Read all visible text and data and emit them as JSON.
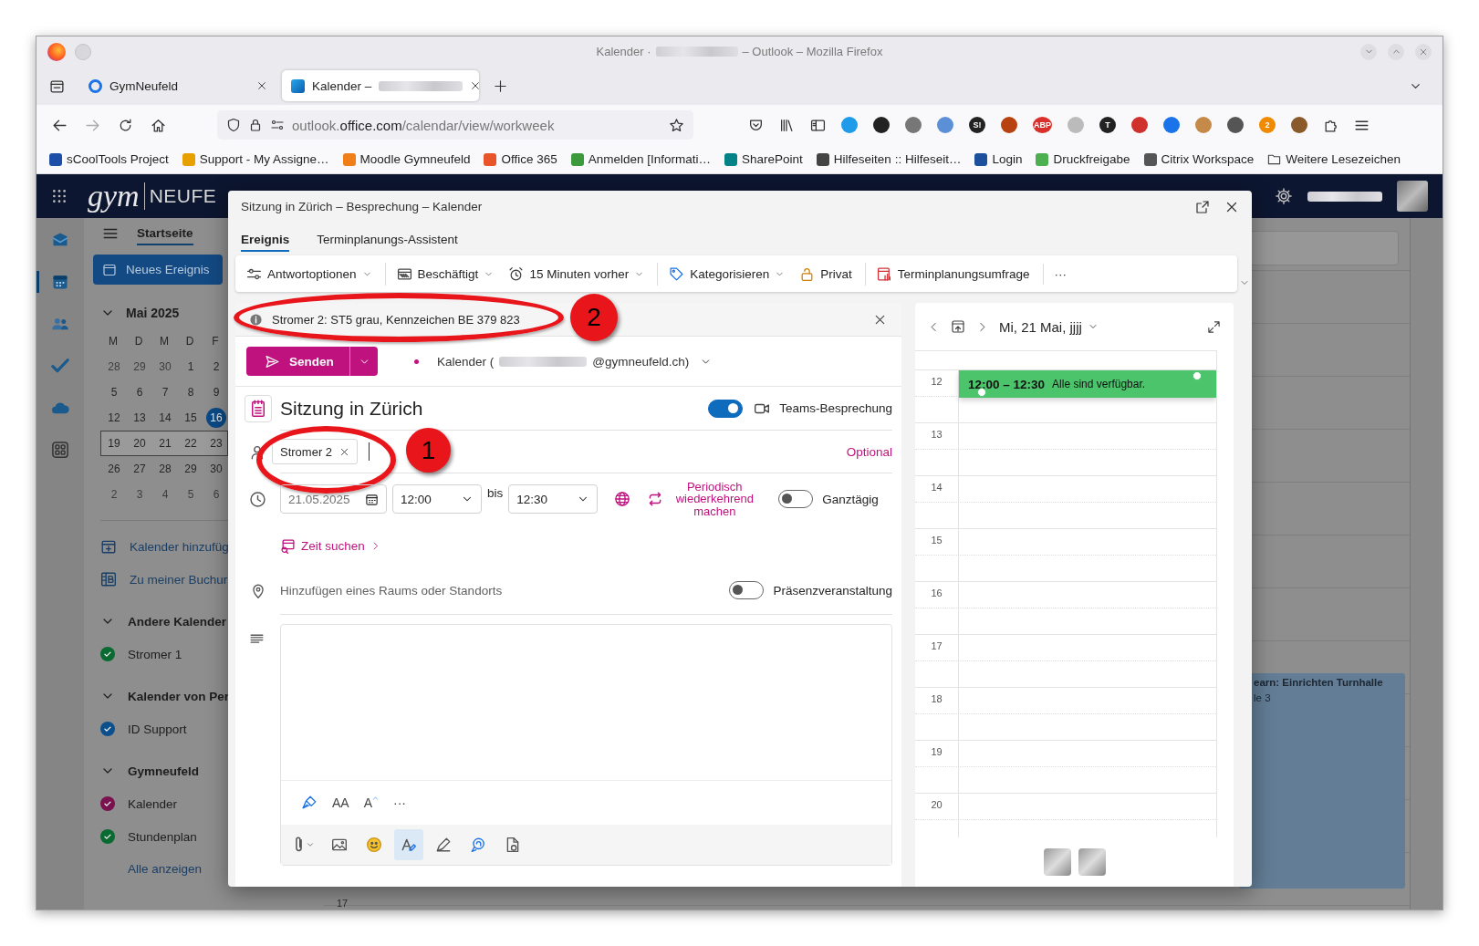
{
  "browser": {
    "title": {
      "prefix": "Kalender ·",
      "redacted": true,
      "suffix": "– Outlook – Mozilla Firefox"
    },
    "tabs": [
      {
        "label": "GymNeufeld",
        "selected": false,
        "redacted": false
      },
      {
        "label": "Kalender –",
        "selected": true,
        "redacted": true
      }
    ],
    "url": [
      {
        "text": "outlook.",
        "strong": false
      },
      {
        "text": "office.com",
        "strong": true
      },
      {
        "text": "/calendar/view/workweek",
        "strong": false
      }
    ],
    "extensions": [
      {
        "kind": "pocket"
      },
      {
        "kind": "library"
      },
      {
        "kind": "sidebar"
      },
      {
        "kind": "dot",
        "color": "#1e9be9"
      },
      {
        "kind": "dot",
        "color": "#222222"
      },
      {
        "kind": "dot",
        "color": "#777777"
      },
      {
        "kind": "dot",
        "color": "#5b8fd6"
      },
      {
        "kind": "badge",
        "label": "S!",
        "color": "#222222"
      },
      {
        "kind": "dot",
        "color": "#b8420f"
      },
      {
        "kind": "badge",
        "label": "ABP",
        "color": "#d9302c"
      },
      {
        "kind": "dot",
        "color": "#bbbbbb"
      },
      {
        "kind": "badge",
        "label": "T",
        "color": "#222222"
      },
      {
        "kind": "dot",
        "color": "#d0312d"
      },
      {
        "kind": "dot",
        "color": "#1a73e8"
      },
      {
        "kind": "dot",
        "color": "#c58a4a"
      },
      {
        "kind": "dot",
        "color": "#555555"
      },
      {
        "kind": "badge",
        "label": "2",
        "color": "#f08a00"
      },
      {
        "kind": "dot",
        "color": "#8a5a2a"
      },
      {
        "kind": "puzzle"
      },
      {
        "kind": "menu"
      }
    ],
    "bookmarks": [
      {
        "kind": "site",
        "label": "sCoolTools Project",
        "color": "#1d4fa8"
      },
      {
        "kind": "site",
        "label": "Support - My Assigne…",
        "color": "#e6a100"
      },
      {
        "kind": "site",
        "label": "Moodle Gymneufeld",
        "color": "#f07f1a"
      },
      {
        "kind": "site",
        "label": "Office 365",
        "color": "#e8552a"
      },
      {
        "kind": "site",
        "label": "Anmelden [Informati…",
        "color": "#3c9a3c"
      },
      {
        "kind": "site",
        "label": "SharePoint",
        "color": "#038387"
      },
      {
        "kind": "site",
        "label": "Hilfeseiten :: Hilfeseit…",
        "color": "#444444"
      },
      {
        "kind": "site",
        "label": "Login",
        "color": "#1c4f9c"
      },
      {
        "kind": "site",
        "label": "Druckfreigabe",
        "color": "#4caf50"
      },
      {
        "kind": "site",
        "label": "Citrix Workspace",
        "color": "#555555"
      },
      {
        "kind": "folder",
        "label": "Weitere Lesezeichen",
        "color": "#444444"
      }
    ]
  },
  "outlook": {
    "brand": {
      "primary": "gym",
      "secondary": "NEUFE"
    },
    "rail": [
      {
        "kind": "mail",
        "selected": false
      },
      {
        "kind": "calendar",
        "selected": true
      },
      {
        "kind": "people",
        "selected": false
      },
      {
        "kind": "todo",
        "selected": false
      },
      {
        "kind": "cloud",
        "selected": false
      },
      {
        "kind": "apps",
        "selected": false
      }
    ],
    "nav_tabs": [
      {
        "label": "Startseite",
        "selected": true
      }
    ],
    "new_event": "Neues Ereignis",
    "mini_calendar": {
      "title": "Mai 2025",
      "weekdays": [
        "M",
        "D",
        "M",
        "D",
        "F"
      ],
      "weeks": [
        {
          "selected": false,
          "days": [
            {
              "label": "28",
              "outside": true,
              "today": false
            },
            {
              "label": "29",
              "outside": true,
              "today": false
            },
            {
              "label": "30",
              "outside": true,
              "today": false
            },
            {
              "label": "1",
              "outside": false,
              "today": false
            },
            {
              "label": "2",
              "outside": false,
              "today": false
            }
          ]
        },
        {
          "selected": false,
          "days": [
            {
              "label": "5",
              "outside": false,
              "today": false
            },
            {
              "label": "6",
              "outside": false,
              "today": false
            },
            {
              "label": "7",
              "outside": false,
              "today": false
            },
            {
              "label": "8",
              "outside": false,
              "today": false
            },
            {
              "label": "9",
              "outside": false,
              "today": false
            }
          ]
        },
        {
          "selected": false,
          "days": [
            {
              "label": "12",
              "outside": false,
              "today": false
            },
            {
              "label": "13",
              "outside": false,
              "today": false
            },
            {
              "label": "14",
              "outside": false,
              "today": false
            },
            {
              "label": "15",
              "outside": false,
              "today": false
            },
            {
              "label": "16",
              "outside": false,
              "today": true
            }
          ]
        },
        {
          "selected": true,
          "days": [
            {
              "label": "19",
              "outside": false,
              "today": false
            },
            {
              "label": "20",
              "outside": false,
              "today": false
            },
            {
              "label": "21",
              "outside": false,
              "today": false
            },
            {
              "label": "22",
              "outside": false,
              "today": false
            },
            {
              "label": "23",
              "outside": false,
              "today": false
            }
          ]
        },
        {
          "selected": false,
          "days": [
            {
              "label": "26",
              "outside": false,
              "today": false
            },
            {
              "label": "27",
              "outside": false,
              "today": false
            },
            {
              "label": "28",
              "outside": false,
              "today": false
            },
            {
              "label": "29",
              "outside": false,
              "today": false
            },
            {
              "label": "30",
              "outside": false,
              "today": false
            }
          ]
        },
        {
          "selected": false,
          "days": [
            {
              "label": "2",
              "outside": true,
              "today": false
            },
            {
              "label": "3",
              "outside": true,
              "today": false
            },
            {
              "label": "4",
              "outside": true,
              "today": false
            },
            {
              "label": "5",
              "outside": true,
              "today": false
            },
            {
              "label": "6",
              "outside": true,
              "today": false
            }
          ]
        }
      ]
    },
    "links": [
      {
        "kind": "add",
        "label": "Kalender hinzufüg"
      },
      {
        "kind": "booking",
        "label": "Zu meiner Buchur"
      }
    ],
    "groups": [
      {
        "title": "Andere Kalender",
        "expanded": true,
        "calendars": [
          {
            "name": "Stromer 1",
            "color": "#0a6b32",
            "checked": true
          }
        ]
      },
      {
        "title": "Kalender von Per",
        "expanded": true,
        "calendars": [
          {
            "name": "ID Support",
            "color": "#0b4f8c",
            "checked": true
          }
        ]
      },
      {
        "title": "Gymneufeld",
        "expanded": true,
        "calendars": [
          {
            "name": "Kalender",
            "color": "#7a1250",
            "checked": true
          },
          {
            "name": "Stundenplan",
            "color": "#0a6b32",
            "checked": true
          }
        ]
      }
    ],
    "show_all": "Alle anzeigen",
    "background_event": {
      "title": "earn: Einrichten Turnhalle",
      "subtitle": "le 3"
    },
    "time_label": "17"
  },
  "dialog": {
    "title": "Sitzung in Zürich – Besprechung – Kalender",
    "tabs": [
      {
        "label": "Ereignis",
        "selected": true
      },
      {
        "label": "Terminplanungs-Assistent",
        "selected": false
      }
    ],
    "ribbon": [
      {
        "kind": "options",
        "label": "Antwortoptionen",
        "dropdown": true,
        "separated": false
      },
      {
        "kind": "busy",
        "label": "Beschäftigt",
        "dropdown": true,
        "separated": true
      },
      {
        "kind": "alarm",
        "label": "15 Minuten vorher",
        "dropdown": true,
        "separated": false
      },
      {
        "kind": "tag",
        "label": "Kategorisieren",
        "dropdown": true,
        "separated": true
      },
      {
        "kind": "lock",
        "label": "Privat",
        "dropdown": false,
        "separated": false
      },
      {
        "kind": "poll",
        "label": "Terminplanungsumfrage",
        "dropdown": false,
        "separated": true
      },
      {
        "kind": "more",
        "label": "···",
        "dropdown": false,
        "separated": true
      }
    ],
    "info": {
      "text": "Stromer 2: ST5 grau, Kennzeichen BE 379 823",
      "annotation": "2"
    },
    "send": {
      "label": "Senden"
    },
    "calendar": {
      "prefix": "Kalender (",
      "redacted": true,
      "suffix": "@gymneufeld.ch)"
    },
    "subject": "Sitzung in Zürich",
    "teams": {
      "label": "Teams-Besprechung",
      "on": true
    },
    "attendees": {
      "annotation": "1",
      "people": [
        {
          "name": "Stromer 2"
        }
      ]
    },
    "optional": "Optional",
    "start_date": "21.05.2025",
    "start_time": "12:00",
    "to": "bis",
    "end_time": "12:30",
    "recurring": "Periodisch wiederkehrend machen",
    "all_day": {
      "label": "Ganztägig",
      "on": false
    },
    "find_time": "Zeit suchen",
    "location": {
      "placeholder": "Hinzufügen eines Raums oder Standorts"
    },
    "in_person": {
      "label": "Präsenzveranstaltung",
      "on": false
    },
    "format_tools": [
      {
        "kind": "brush"
      },
      {
        "kind": "text",
        "label": "AA"
      },
      {
        "kind": "grow",
        "label": "A"
      },
      {
        "kind": "text",
        "label": "···"
      }
    ],
    "insert_tools": [
      {
        "kind": "attach",
        "selected": false
      },
      {
        "kind": "image",
        "selected": false
      },
      {
        "kind": "emoji",
        "selected": false
      },
      {
        "kind": "editor",
        "selected": true
      },
      {
        "kind": "sign",
        "selected": false
      },
      {
        "kind": "loop",
        "selected": false
      },
      {
        "kind": "doc",
        "selected": false
      }
    ],
    "scheduler": {
      "date": "Mi, 21 Mai, jjjj",
      "hours": [
        "12",
        "13",
        "14",
        "15",
        "16",
        "17",
        "18",
        "19",
        "20"
      ],
      "event": {
        "time": "12:00 – 12:30",
        "text": "Alle sind verfügbar."
      }
    }
  }
}
